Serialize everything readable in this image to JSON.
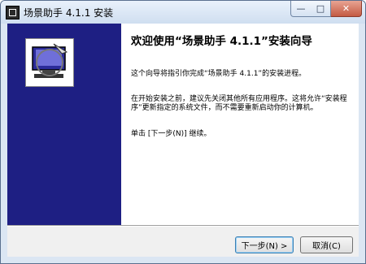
{
  "window": {
    "title": "场景助手 4.1.1 安装"
  },
  "caption": {
    "minimize": "—",
    "maximize": "□",
    "close": "✕"
  },
  "content": {
    "heading": "欢迎使用“场景助手 4.1.1”安装向导",
    "p1": "这个向导将指引你完成“场景助手 4.1.1”的安装进程。",
    "p2": "在开始安装之前，建议先关闭其他所有应用程序。这将允许“安装程序”更新指定的系统文件，而不需要重新启动你的计算机。",
    "p3": "单击 [下一步(N)] 继续。"
  },
  "buttons": {
    "next": "下一步(N) >",
    "cancel": "取消(C)"
  }
}
